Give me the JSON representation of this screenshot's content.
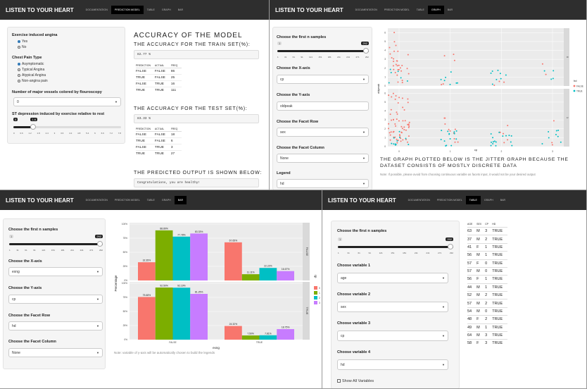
{
  "app_title": "LISTEN TO YOUR HEART",
  "tabs": [
    "DOCUMENTATION",
    "PREDICTION MODEL",
    "TABLE",
    "GRAPH",
    "BAR"
  ],
  "p1": {
    "angina_label": "Exercise induced angina",
    "angina_options": [
      "Yes",
      "No"
    ],
    "cp_label": "Chest Pain Type",
    "cp_options": [
      "Asymptomatic",
      "Typical Angina",
      "Atypical Angina",
      "Non-angina pain"
    ],
    "vessels_label": "Number of major vessels colored by flouroscopy",
    "vessels_value": "0",
    "st_label": "ST depression induced by exercise relative to rest",
    "st_min": "0",
    "st_value": "1.6",
    "st_ticks": [
      "0",
      "0.6",
      "1.2",
      "1.8",
      "2.4",
      "3",
      "3.6",
      "4.2",
      "4.8",
      "5.4",
      "6",
      "6.6",
      "7.2",
      "7.8"
    ],
    "accuracy_title": "ACCURACY OF THE MODEL",
    "train_title": "THE ACCURACY FOR THE TRAIN SET(%):",
    "train_value": "82.77 %",
    "table_headers": [
      "PREDICTION",
      "ACTUAL",
      "FREQ"
    ],
    "train_rows": [
      [
        "FALSE",
        "FALSE",
        "86"
      ],
      [
        "TRUE",
        "FALSE",
        "25"
      ],
      [
        "FALSE",
        "TRUE",
        "16"
      ],
      [
        "TRUE",
        "TRUE",
        "111"
      ]
    ],
    "test_title": "THE ACCURACY FOR THE TEST SET(%):",
    "test_value": "83.33 %",
    "test_rows": [
      [
        "FALSE",
        "FALSE",
        "18"
      ],
      [
        "TRUE",
        "FALSE",
        "6"
      ],
      [
        "FALSE",
        "TRUE",
        "3"
      ],
      [
        "TRUE",
        "TRUE",
        "27"
      ]
    ],
    "predicted_title": "THE PREDICTED OUTPUT IS SHOWN BELOW:",
    "predicted_value": "Congratulations, you are healthy!"
  },
  "p2": {
    "samples_label": "Choose the first n samples",
    "samples_min": "1",
    "samples_value": "292",
    "samples_ticks": [
      "1",
      "31",
      "61",
      "91",
      "121",
      "151",
      "181",
      "211",
      "241",
      "271",
      "292"
    ],
    "x_label": "Choose the X-axis",
    "x_value": "cp",
    "y_label": "Choose the Y-axis",
    "y_value": "oldpeak",
    "row_label": "Choose the Facet Row",
    "row_value": "sex",
    "col_label": "Choose the Facet Column",
    "col_value": "None",
    "legend_label": "Legend",
    "legend_value": "hd",
    "plot_ylabel": "oldpeak",
    "plot_xlabel": "cp",
    "plot_facets": [
      "0",
      "1"
    ],
    "plot_xticks": [
      "0",
      "1",
      "2",
      "3"
    ],
    "plot_yticks": [
      "0",
      "1",
      "2",
      "3",
      "4",
      "5",
      "6"
    ],
    "legend_title": "hd",
    "legend_items": [
      "FALSE",
      "TRUE"
    ],
    "colors": {
      "false": "#f8766d",
      "true": "#00bfc4"
    },
    "caption": "THE GRAPH PLOTTED BELOW IS THE JITTER GRAPH BECAUSE THE DATASET CONSISTS OF MOSTLY DISCRETE DATA",
    "note": "Note: If possible, please avoid from choosing continuous variable as facets input, it would not be your desired output"
  },
  "p3": {
    "samples_label": "Choose the first n samples",
    "samples_min": "1",
    "samples_value": "292",
    "samples_ticks": [
      "1",
      "31",
      "61",
      "91",
      "121",
      "151",
      "181",
      "211",
      "241",
      "271",
      "292"
    ],
    "x_label": "Choose the X-axis",
    "x_value": "exng",
    "y_label": "Choose the Y-axis",
    "y_value": "cp",
    "row_label": "Choose the Facet Row",
    "row_value": "hd",
    "col_label": "Choose the Facet Column",
    "col_value": "None",
    "note": "Note: variable of y-axis will be automatically chosen to build the legends"
  },
  "p4": {
    "samples_label": "Choose the first n samples",
    "samples_min": "1",
    "samples_value": "292",
    "samples_ticks": [
      "1",
      "31",
      "61",
      "91",
      "121",
      "151",
      "181",
      "211",
      "241",
      "271",
      "292"
    ],
    "v1_label": "Choose variable 1",
    "v1_value": "age",
    "v2_label": "Choose variable 2",
    "v2_value": "sex",
    "v3_label": "Choose variable 3",
    "v3_value": "cp",
    "v4_label": "Choose variable 4",
    "v4_value": "hd",
    "show_all_label": "Show All Variables",
    "table_headers": [
      "AGE",
      "SEX",
      "CP",
      "HD"
    ],
    "rows": [
      [
        "63",
        "M",
        "3",
        "TRUE"
      ],
      [
        "37",
        "M",
        "2",
        "TRUE"
      ],
      [
        "41",
        "F",
        "1",
        "TRUE"
      ],
      [
        "56",
        "M",
        "1",
        "TRUE"
      ],
      [
        "57",
        "F",
        "0",
        "TRUE"
      ],
      [
        "57",
        "M",
        "0",
        "TRUE"
      ],
      [
        "56",
        "F",
        "1",
        "TRUE"
      ],
      [
        "44",
        "M",
        "1",
        "TRUE"
      ],
      [
        "52",
        "M",
        "2",
        "TRUE"
      ],
      [
        "57",
        "M",
        "2",
        "TRUE"
      ],
      [
        "54",
        "M",
        "0",
        "TRUE"
      ],
      [
        "48",
        "F",
        "2",
        "TRUE"
      ],
      [
        "49",
        "M",
        "1",
        "TRUE"
      ],
      [
        "64",
        "M",
        "3",
        "TRUE"
      ],
      [
        "58",
        "F",
        "3",
        "TRUE"
      ]
    ]
  },
  "chart_data": [
    {
      "type": "scatter",
      "x": [
        0,
        1,
        2,
        3
      ],
      "xlabel": "cp",
      "ylabel": "oldpeak",
      "ylim": [
        0,
        6.5
      ],
      "facets": [
        "0",
        "1"
      ],
      "legend": {
        "title": "hd",
        "items": [
          "FALSE",
          "TRUE"
        ]
      }
    },
    {
      "type": "bar",
      "categories": [
        "FALSE",
        "TRUE"
      ],
      "xlabel": "exng",
      "ylabel": "Percentage",
      "legend_title": "cp",
      "legend_items": [
        "0",
        "1",
        "2",
        "3"
      ],
      "colors": [
        "#f8766d",
        "#7cae00",
        "#00bfc4",
        "#c77cff"
      ],
      "facets": [
        {
          "name": "FALSE",
          "series": [
            {
              "name": "0",
              "values": [
                32.35,
                67.65
              ]
            },
            {
              "name": "1",
              "values": [
                88.89,
                11.11
              ]
            },
            {
              "name": "2",
              "values": [
                77.78,
                22.22
              ]
            },
            {
              "name": "3",
              "values": [
                83.33,
                16.67
              ]
            }
          ]
        },
        {
          "name": "TRUE",
          "series": [
            {
              "name": "0",
              "values": [
                75.68,
                24.32
              ]
            },
            {
              "name": "1",
              "values": [
                92.5,
                7.5
              ]
            },
            {
              "name": "2",
              "values": [
                92.19,
                7.81
              ]
            },
            {
              "name": "3",
              "values": [
                81.25,
                18.75
              ]
            }
          ]
        }
      ],
      "yticks": [
        "0%",
        "25%",
        "50%",
        "75%",
        "100%"
      ]
    }
  ]
}
